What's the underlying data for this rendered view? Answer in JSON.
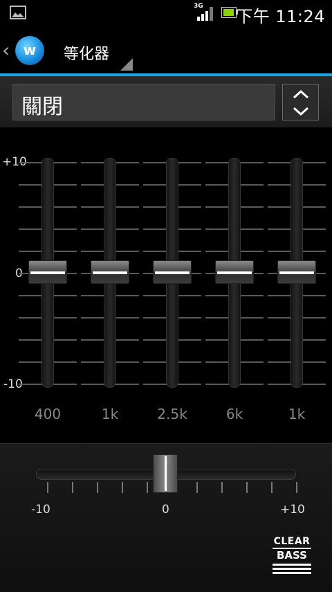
{
  "status_bar": {
    "network_label": "3G",
    "time": "下午 11:24",
    "icons": [
      "gallery-icon",
      "signal-icon",
      "battery-icon"
    ]
  },
  "action_bar": {
    "title": "等化器",
    "app_icon_letter": "w",
    "accent_color": "#1aa7e6"
  },
  "preset": {
    "selected": "關閉"
  },
  "equalizer": {
    "scale_top": "+10",
    "scale_mid": "0",
    "scale_bottom": "-10",
    "bands": [
      {
        "label": "400",
        "value": 0
      },
      {
        "label": "1k",
        "value": 0
      },
      {
        "label": "2.5k",
        "value": 0
      },
      {
        "label": "6k",
        "value": 0
      },
      {
        "label": "1k",
        "value": 0
      }
    ]
  },
  "clear_bass": {
    "min_label": "-10",
    "mid_label": "0",
    "max_label": "+10",
    "value": 0,
    "logo_line1": "CLEAR",
    "logo_line2": "BASS"
  }
}
